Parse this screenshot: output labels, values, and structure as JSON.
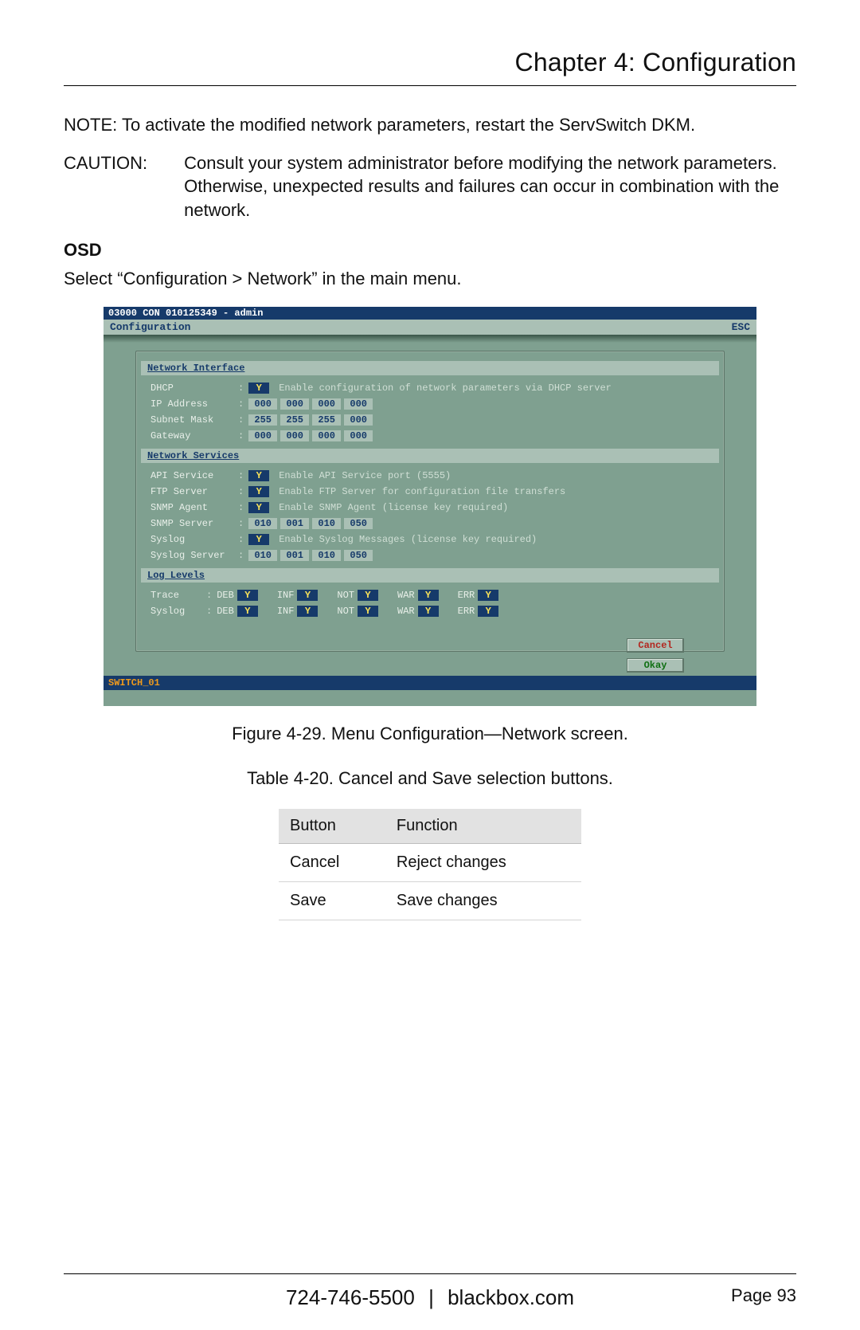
{
  "chapter_title": "Chapter 4: Configuration",
  "note_text": "NOTE: To activate the modified network parameters, restart the ServSwitch DKM.",
  "caution_label": "CAUTION:",
  "caution_text": "Consult your system administrator before modifying the network parameters. Otherwise, unexpected results and failures can occur in combination with the network.",
  "osd_heading": "OSD",
  "osd_instruction": "Select “Configuration > Network” in the main menu.",
  "screenshot": {
    "titlebar": "03000 CON 010125349 - admin",
    "menu_label": "Configuration",
    "esc_label": "ESC",
    "footer": "SWITCH_01",
    "sections": {
      "interface": {
        "title": "Network Interface",
        "dhcp": {
          "label": "DHCP",
          "value": "Y",
          "hint": "Enable configuration of network parameters via DHCP server"
        },
        "ip": {
          "label": "IP Address",
          "o1": "000",
          "o2": "000",
          "o3": "000",
          "o4": "000"
        },
        "mask": {
          "label": "Subnet Mask",
          "o1": "255",
          "o2": "255",
          "o3": "255",
          "o4": "000"
        },
        "gw": {
          "label": "Gateway",
          "o1": "000",
          "o2": "000",
          "o3": "000",
          "o4": "000"
        }
      },
      "services": {
        "title": "Network Services",
        "api": {
          "label": "API Service",
          "value": "Y",
          "hint": "Enable API Service port (5555)"
        },
        "ftp": {
          "label": "FTP Server",
          "value": "Y",
          "hint": "Enable FTP Server for configuration file transfers"
        },
        "snmpa": {
          "label": "SNMP Agent",
          "value": "Y",
          "hint": "Enable SNMP Agent (license key required)"
        },
        "snmps": {
          "label": "SNMP Server",
          "o1": "010",
          "o2": "001",
          "o3": "010",
          "o4": "050"
        },
        "syslog": {
          "label": "Syslog",
          "value": "Y",
          "hint": "Enable Syslog Messages (license key required)"
        },
        "syslogs": {
          "label": "Syslog Server",
          "o1": "010",
          "o2": "001",
          "o3": "010",
          "o4": "050"
        }
      },
      "loglevels": {
        "title": "Log Levels",
        "rows": {
          "trace": {
            "label": "Trace",
            "deb": "Y",
            "inf": "Y",
            "not": "Y",
            "war": "Y",
            "err": "Y"
          },
          "syslog": {
            "label": "Syslog",
            "deb": "Y",
            "inf": "Y",
            "not": "Y",
            "war": "Y",
            "err": "Y"
          }
        },
        "tags": {
          "deb": "DEB",
          "inf": "INF",
          "not": "NOT",
          "war": "WAR",
          "err": "ERR"
        }
      }
    },
    "buttons": {
      "cancel": "Cancel",
      "okay": "Okay"
    }
  },
  "figure_caption": "Figure 4-29. Menu Configuration—Network screen.",
  "table_caption": "Table 4-20. Cancel and Save selection buttons.",
  "button_table": {
    "head": {
      "button": "Button",
      "function": "Function"
    },
    "rows": [
      {
        "button": "Cancel",
        "function": "Reject changes"
      },
      {
        "button": "Save",
        "function": "Save changes"
      }
    ]
  },
  "footer": {
    "phone": "724-746-5500",
    "sep": "|",
    "site": "blackbox.com",
    "page": "Page 93"
  }
}
